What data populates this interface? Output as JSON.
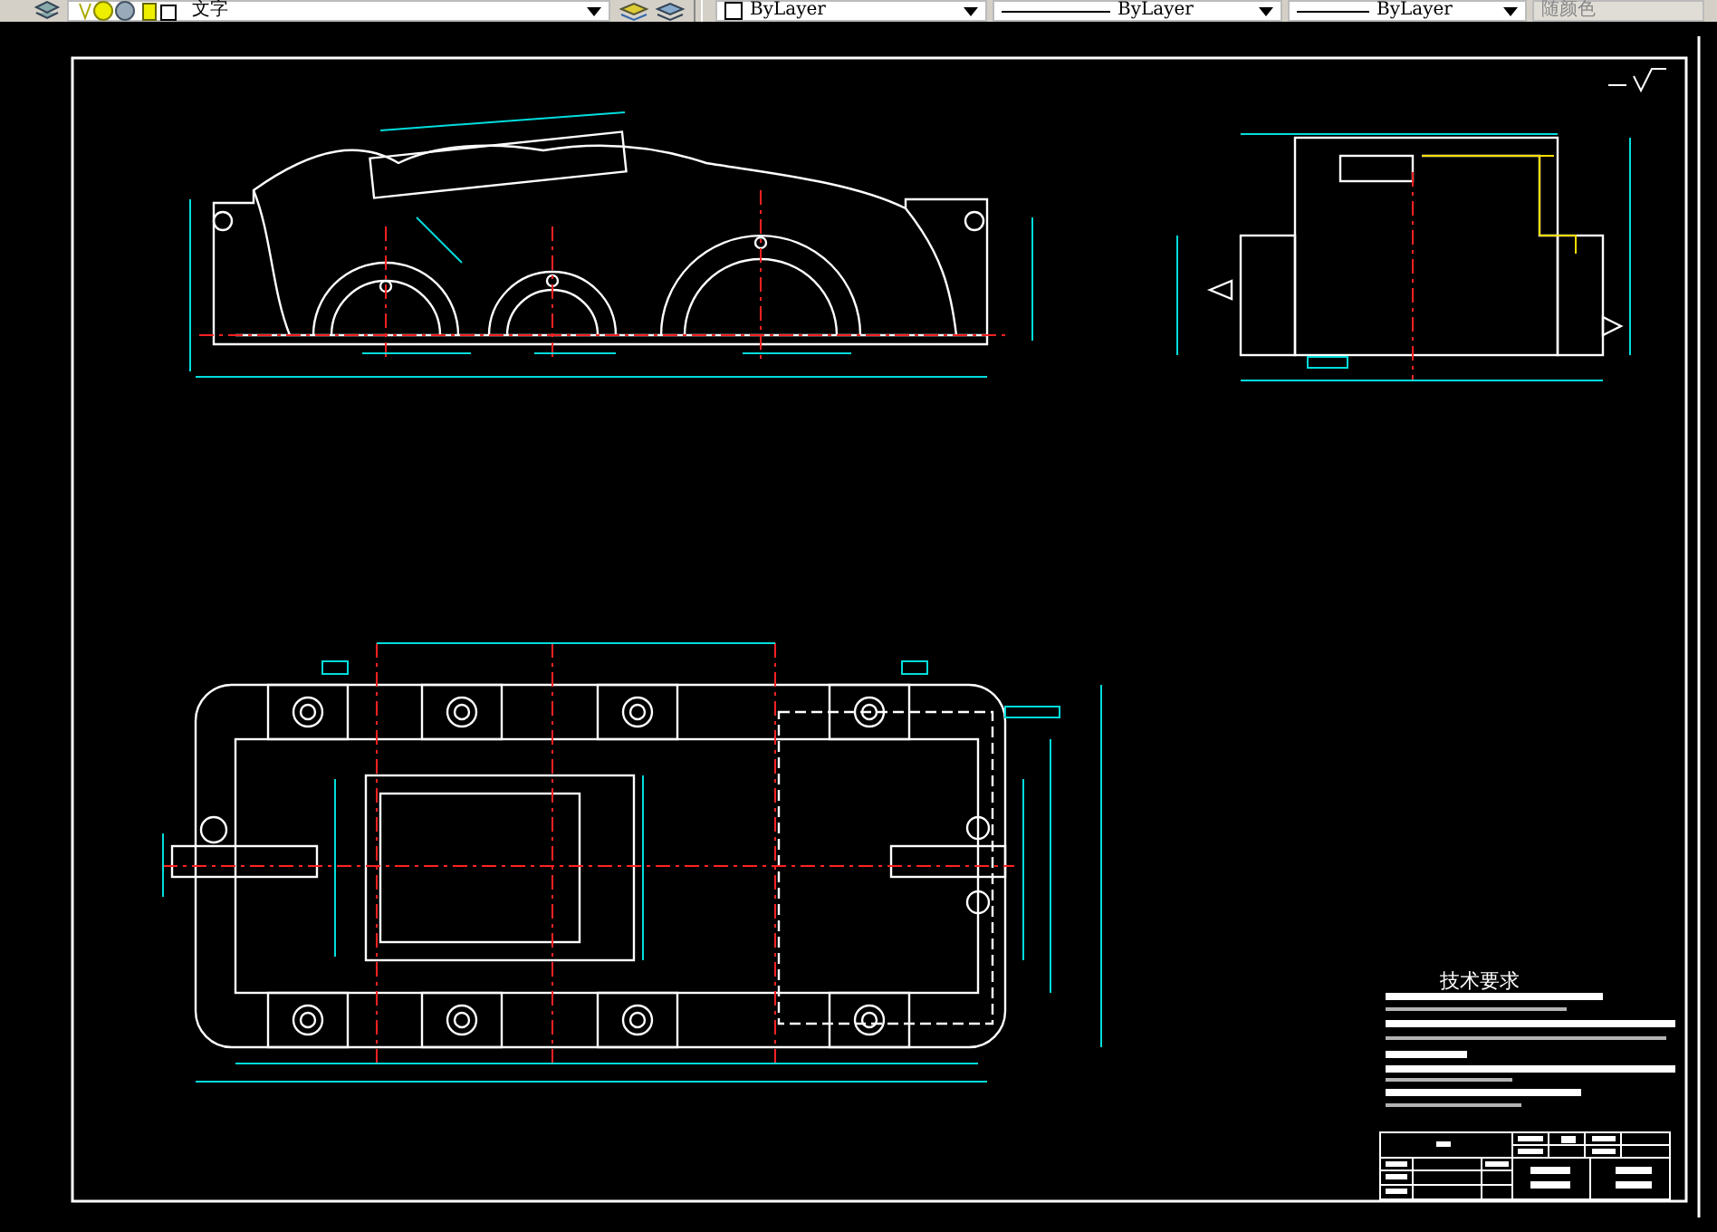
{
  "toolbar": {
    "layer": {
      "value": "文字"
    },
    "color": {
      "value": "ByLayer"
    },
    "linetype": {
      "value": "ByLayer"
    },
    "lineweight": {
      "value": "ByLayer"
    },
    "plot_style": {
      "value": "随颜色",
      "disabled": true
    }
  },
  "drawing": {
    "notes_heading": "技术要求"
  }
}
